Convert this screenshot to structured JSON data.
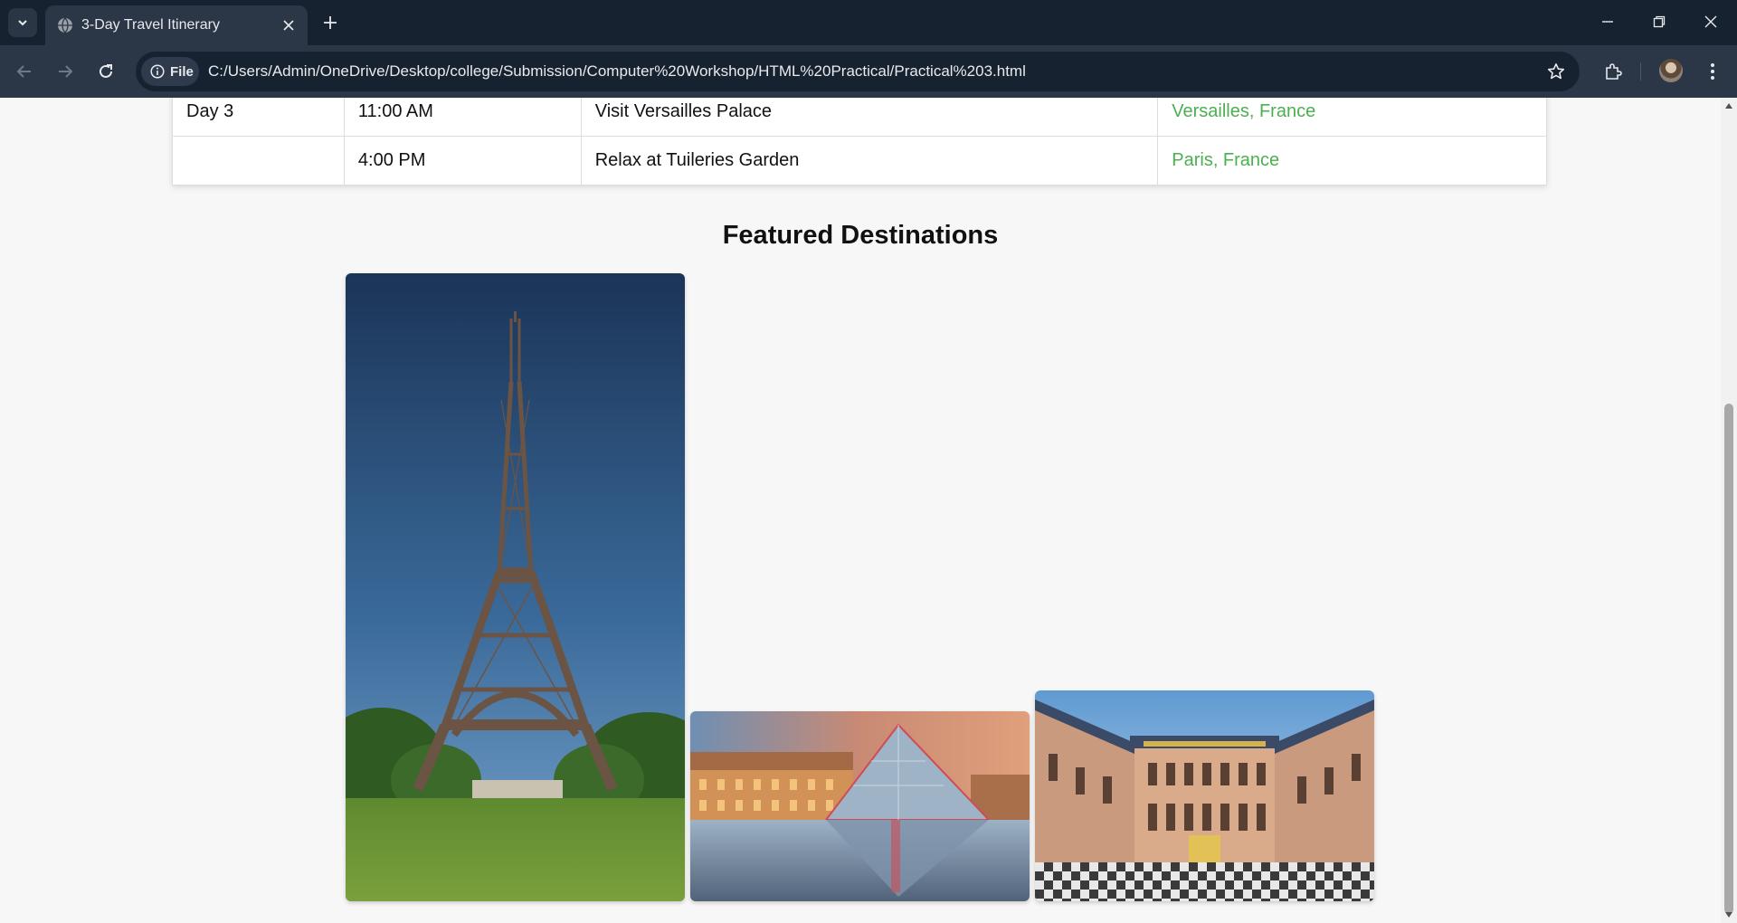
{
  "browser": {
    "tab": {
      "title": "3-Day Travel Itinerary",
      "favicon": "globe-icon"
    },
    "address": {
      "chip_label": "File",
      "url": "C:/Users/Admin/OneDrive/Desktop/college/Submission/Computer%20Workshop/HTML%20Practical/Practical%203.html"
    },
    "icons": [
      "tab-search-icon",
      "close-icon",
      "plus-icon",
      "minimize-icon",
      "restore-icon",
      "back-icon",
      "forward-icon",
      "reload-icon",
      "info-icon",
      "star-icon",
      "extensions-icon",
      "profile-avatar",
      "more-vert-icon"
    ]
  },
  "itinerary": {
    "rows": [
      {
        "day": "Day 3",
        "time": "11:00 AM",
        "activity": "Visit Versailles Palace",
        "location": "Versailles, France"
      },
      {
        "day": "",
        "time": "4:00 PM",
        "activity": "Relax at Tuileries Garden",
        "location": "Paris, France"
      }
    ]
  },
  "featured": {
    "title": "Featured Destinations",
    "images": [
      "eiffel-tower-photo",
      "louvre-pyramid-photo",
      "versailles-palace-photo"
    ]
  },
  "colors": {
    "location_text": "#4caf50",
    "chrome_dark": "#172231",
    "chrome_toolbar": "#2b3747",
    "page_background": "#f7f7f7"
  }
}
